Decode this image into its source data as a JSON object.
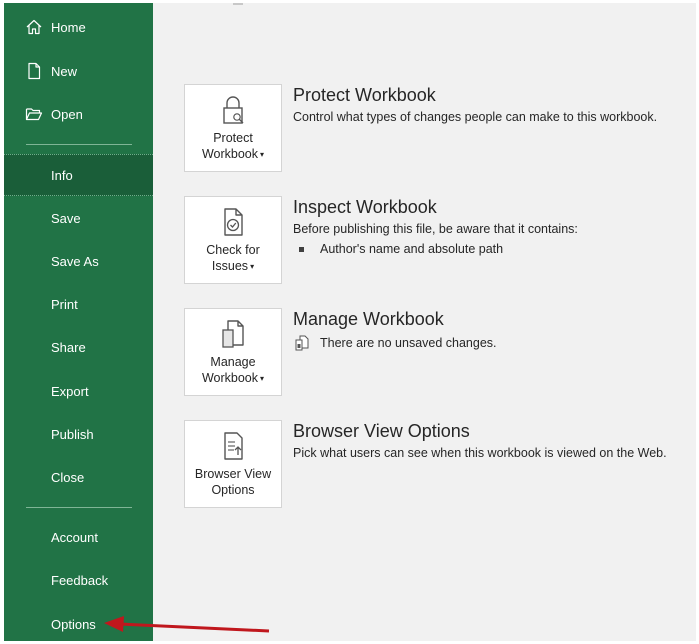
{
  "sidebar": {
    "top_items": [
      {
        "label": "Home",
        "icon": "home-icon"
      },
      {
        "label": "New",
        "icon": "new-document-icon"
      },
      {
        "label": "Open",
        "icon": "folder-open-icon"
      }
    ],
    "middle_items": [
      {
        "label": "Info",
        "selected": true
      },
      {
        "label": "Save"
      },
      {
        "label": "Save As"
      },
      {
        "label": "Print"
      },
      {
        "label": "Share"
      },
      {
        "label": "Export"
      },
      {
        "label": "Publish"
      },
      {
        "label": "Close"
      }
    ],
    "bottom_items": [
      {
        "label": "Account"
      },
      {
        "label": "Feedback"
      },
      {
        "label": "Options"
      }
    ],
    "background_color": "#217346",
    "selected_color": "#1a5e39"
  },
  "cards": {
    "protect": {
      "button_line1": "Protect",
      "button_line2": "Workbook",
      "caret": "▾",
      "title": "Protect Workbook",
      "description": "Control what types of changes people can make to this workbook.",
      "icon": "lock-icon"
    },
    "inspect": {
      "button_line1": "Check for",
      "button_line2": "Issues",
      "caret": "▾",
      "title": "Inspect Workbook",
      "description": "Before publishing this file, be aware that it contains:",
      "bullet": "Author's name and absolute path",
      "icon": "check-document-icon"
    },
    "manage": {
      "button_line1": "Manage",
      "button_line2": "Workbook",
      "caret": "▾",
      "title": "Manage Workbook",
      "status": "There are no unsaved changes.",
      "icon": "manage-documents-icon"
    },
    "browser": {
      "button_line1": "Browser View",
      "button_line2": "Options",
      "title": "Browser View Options",
      "description": "Pick what users can see when this workbook is viewed on the Web.",
      "icon": "browser-view-icon"
    }
  },
  "annotation": {
    "arrow_color": "#c0171d"
  }
}
